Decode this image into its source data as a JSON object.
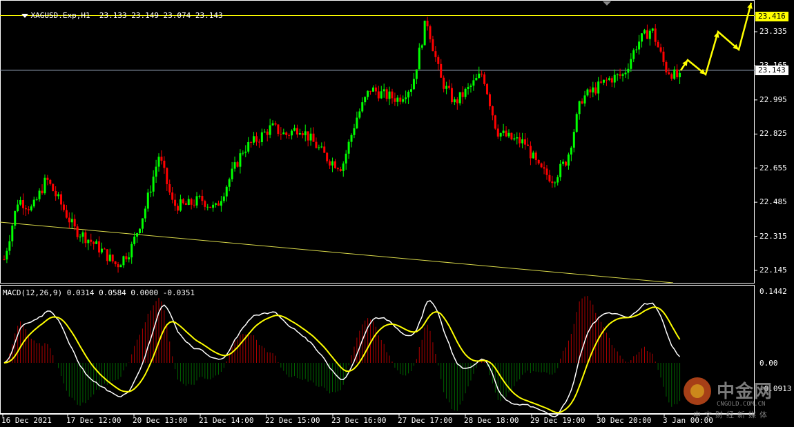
{
  "header": {
    "symbol": "XAGUSD.Exp,H1",
    "ohlc": "23.133 23.149 23.074 23.143"
  },
  "price_axis": {
    "labels": [
      "23.335",
      "23.165",
      "22.995",
      "22.825",
      "22.655",
      "22.485",
      "22.315",
      "22.145"
    ],
    "high_tag": "23.416",
    "current_tag": "23.143"
  },
  "macd": {
    "header": "MACD(12,26,9) 0.0314 0.0584 0.0000 -0.0351",
    "axis_labels": [
      "0.1442",
      "0.00",
      "-0.0913"
    ]
  },
  "time_axis": {
    "labels": [
      "16 Dec 2021",
      "17 Dec 12:00",
      "20 Dec 13:00",
      "21 Dec 14:00",
      "22 Dec 15:00",
      "23 Dec 16:00",
      "27 Dec 17:00",
      "28 Dec 18:00",
      "29 Dec 19:00",
      "30 Dec 20:00",
      "3 Jan 00:00"
    ]
  },
  "watermark": {
    "title": "中金网",
    "url": "CNGOLD.COM.CN",
    "slogan": "中文财经新媒体"
  },
  "colors": {
    "bull": "#00ff00",
    "bear": "#ff0000",
    "grid": "#ffffff",
    "high_line": "#ffff00",
    "signal": "#ffff00",
    "macd_line": "#ffffff",
    "hist_pos": "#b00000",
    "hist_neg": "#006400"
  },
  "chart_data": {
    "type": "candlestick",
    "symbol": "XAGUSD",
    "timeframe": "H1",
    "y_range": [
      22.1,
      23.45
    ],
    "anchors_x_label": [
      "16 Dec 2021",
      "17 Dec 12:00",
      "20 Dec 13:00",
      "21 Dec 14:00",
      "22 Dec 15:00",
      "23 Dec 16:00",
      "27 Dec 17:00",
      "28 Dec 18:00",
      "29 Dec 19:00",
      "30 Dec 20:00",
      "3 Jan 00:00"
    ],
    "close_path": [
      22.2,
      22.5,
      22.45,
      22.6,
      22.48,
      22.35,
      22.3,
      22.24,
      22.17,
      22.25,
      22.45,
      22.72,
      22.47,
      22.47,
      22.5,
      22.45,
      22.6,
      22.75,
      22.8,
      22.86,
      22.82,
      22.86,
      22.78,
      22.7,
      22.66,
      22.9,
      23.05,
      23.02,
      23.0,
      23.07,
      23.4,
      23.1,
      22.98,
      23.05,
      23.13,
      22.84,
      22.8,
      22.78,
      22.65,
      22.6,
      22.7,
      23.0,
      23.05,
      23.1,
      23.12,
      23.28,
      23.35,
      23.15,
      23.1
    ],
    "current_price": 23.143,
    "high_level": 23.416,
    "macd_params": [
      12,
      26,
      9
    ],
    "macd_values": [
      0.0314,
      0.0584,
      0.0,
      -0.0351
    ]
  }
}
